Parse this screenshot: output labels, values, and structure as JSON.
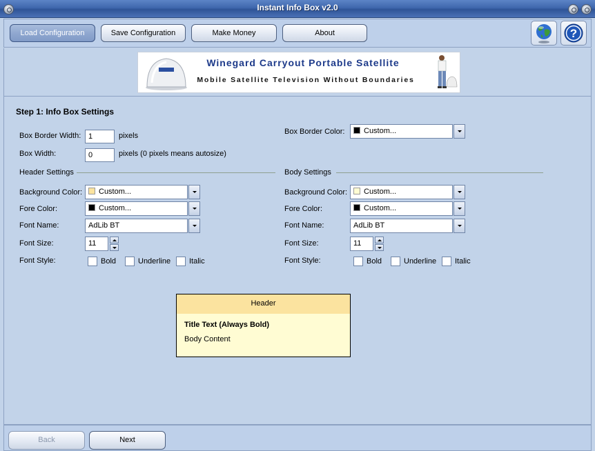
{
  "window": {
    "title": "Instant Info Box v2.0"
  },
  "toolbar": {
    "load": "Load Configuration",
    "save": "Save Configuration",
    "make_money": "Make Money",
    "about": "About",
    "web_icon": "globe-icon",
    "help_icon": "help-icon"
  },
  "banner": {
    "line1": "Winegard Carryout Portable Satellite",
    "line2": "Mobile Satellite Television Without Boundaries"
  },
  "step": {
    "title": "Step 1: Info Box Settings"
  },
  "box": {
    "border_width_label": "Box Border Width:",
    "border_width_value": "1",
    "border_width_unit": "pixels",
    "width_label": "Box Width:",
    "width_value": "0",
    "width_unit": "pixels (0 pixels means autosize)",
    "border_color_label": "Box Border Color:",
    "border_color_value": "Custom...",
    "border_color_swatch": "#000000"
  },
  "header": {
    "section": "Header Settings",
    "bg_label": "Background Color:",
    "bg_value": "Custom...",
    "bg_swatch": "#fbe39f",
    "fore_label": "Fore Color:",
    "fore_value": "Custom...",
    "fore_swatch": "#000000",
    "font_name_label": "Font Name:",
    "font_name_value": "AdLib BT",
    "font_size_label": "Font Size:",
    "font_size_value": "11",
    "font_style_label": "Font Style:",
    "bold": "Bold",
    "underline": "Underline",
    "italic": "Italic"
  },
  "body": {
    "section": "Body Settings",
    "bg_label": "Background Color:",
    "bg_value": "Custom...",
    "bg_swatch": "#fffcd3",
    "fore_label": "Fore Color:",
    "fore_value": "Custom...",
    "fore_swatch": "#000000",
    "font_name_label": "Font Name:",
    "font_name_value": "AdLib BT",
    "font_size_label": "Font Size:",
    "font_size_value": "11",
    "font_style_label": "Font Style:",
    "bold": "Bold",
    "underline": "Underline",
    "italic": "Italic"
  },
  "preview": {
    "header": "Header",
    "title": "Title Text (Always Bold)",
    "body": "Body Content"
  },
  "footer": {
    "back": "Back",
    "next": "Next"
  }
}
